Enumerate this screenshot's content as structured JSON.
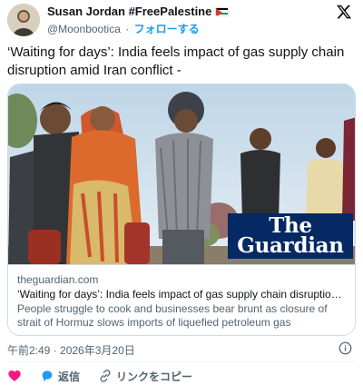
{
  "user": {
    "display_name": "Susan Jordan #FreePalestine",
    "flag_icon": "palestine-flag-icon",
    "handle": "@Moonbootica",
    "separator": "·",
    "follow_label": "フォローする"
  },
  "tweet": {
    "text": "‘Waiting for days’: India feels impact of gas supply chain disruption amid Iran conflict -"
  },
  "card": {
    "logo_line1": "The",
    "logo_line2": "Guardian",
    "domain": "theguardian.com",
    "title": "‘Waiting for days’: India feels impact of gas supply chain disruption amid Iran conflict",
    "description": "People struggle to cook and businesses bear brunt as closure of strait of Hormuz slows imports of liquefied petroleum gas"
  },
  "meta": {
    "timestamp": "午前2:49 · 2026年3月20日"
  },
  "actions": {
    "like_icon": "heart-icon",
    "reply_label": "返信",
    "copy_link_label": "リンクをコピー"
  },
  "colors": {
    "accent": "#1d9bf0",
    "like": "#f91880",
    "guardian_blue": "#052962",
    "text_secondary": "#536471"
  }
}
